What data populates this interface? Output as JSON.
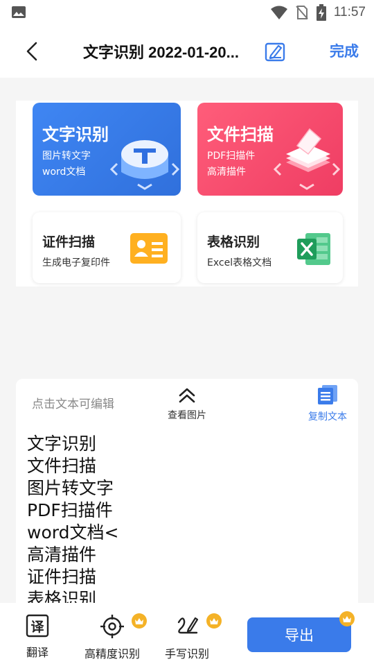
{
  "status_bar": {
    "time": "11:57"
  },
  "nav": {
    "title": "文字识别 2022-01-20...",
    "done_label": "完成"
  },
  "preview": {
    "cards": [
      {
        "title": "文字识别",
        "sub1": "图片转文字",
        "sub2": "word文档"
      },
      {
        "title": "文件扫描",
        "sub1": "PDF扫描件",
        "sub2": "高清描件"
      },
      {
        "title": "证件扫描",
        "sub1": "生成电子复印件"
      },
      {
        "title": "表格识别",
        "sub1": "Excel表格文档"
      }
    ]
  },
  "ocr": {
    "hint": "点击文本可编辑",
    "view_image_label": "查看图片",
    "copy_label": "复制文本",
    "lines": [
      "文字识别",
      "文件扫描",
      "图片转文字",
      "PDF扫描件",
      "word文档<",
      "高清描件",
      "证件扫描",
      "表格识别"
    ]
  },
  "toolbar": {
    "translate_label": "翻译",
    "high_precision_label": "高精度识别",
    "handwriting_label": "手写识别",
    "export_label": "导出"
  },
  "colors": {
    "accent": "#3a7bea",
    "blue_card": "#3a7be8",
    "red_card": "#f24a6c",
    "crown": "#f4b227"
  }
}
